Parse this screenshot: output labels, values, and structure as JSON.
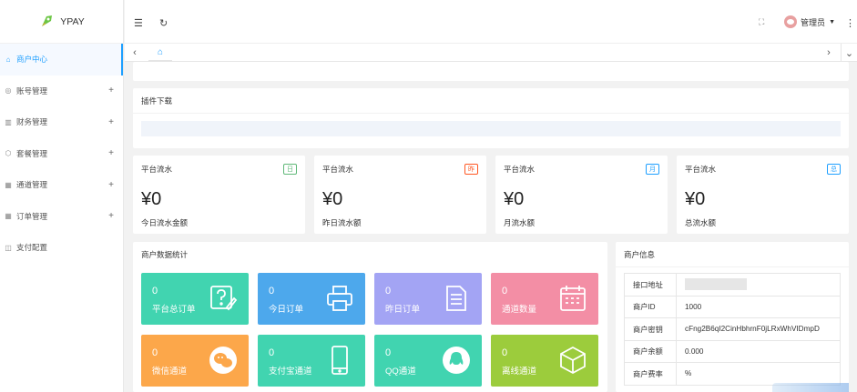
{
  "app": {
    "name": "YPAY"
  },
  "sidebar": {
    "items": [
      {
        "label": "商户中心",
        "icon": "home-icon"
      },
      {
        "label": "账号管理",
        "icon": "user-circle-icon"
      },
      {
        "label": "财务管理",
        "icon": "finance-icon"
      },
      {
        "label": "套餐管理",
        "icon": "package-icon"
      },
      {
        "label": "通道管理",
        "icon": "channel-icon"
      },
      {
        "label": "订单管理",
        "icon": "order-icon"
      },
      {
        "label": "支付配置",
        "icon": "config-icon"
      }
    ]
  },
  "topbar": {
    "user_label": "管理员"
  },
  "plugin": {
    "title": "插件下载"
  },
  "flows": [
    {
      "title": "平台流水",
      "badge": "日",
      "badge_color": "#5fb878",
      "value": "¥0",
      "sub": "今日流水金额"
    },
    {
      "title": "平台流水",
      "badge": "昨",
      "badge_color": "#ff5722",
      "value": "¥0",
      "sub": "昨日流水额"
    },
    {
      "title": "平台流水",
      "badge": "月",
      "badge_color": "#1e9fff",
      "value": "¥0",
      "sub": "月流水额"
    },
    {
      "title": "平台流水",
      "badge": "总",
      "badge_color": "#1e9fff",
      "value": "¥0",
      "sub": "总流水额"
    }
  ],
  "stats": {
    "title": "商户数据统计",
    "tiles": [
      {
        "value": "0",
        "label": "平台总订单",
        "color": "#41d4b0",
        "icon": "question-edit-icon"
      },
      {
        "value": "0",
        "label": "今日订单",
        "color": "#4da8ec",
        "icon": "printer-icon"
      },
      {
        "value": "0",
        "label": "昨日订单",
        "color": "#a3a4f4",
        "icon": "document-icon"
      },
      {
        "value": "0",
        "label": "通道数量",
        "color": "#f38ea5",
        "icon": "calendar-icon"
      },
      {
        "value": "0",
        "label": "微信通道",
        "color": "#fca74a",
        "icon": "wechat-icon"
      },
      {
        "value": "0",
        "label": "支付宝通道",
        "color": "#41d4b0",
        "icon": "phone-icon"
      },
      {
        "value": "0",
        "label": "QQ通道",
        "color": "#41d4b0",
        "icon": "qq-icon"
      },
      {
        "value": "0",
        "label": "离线通道",
        "color": "#9ccc3c",
        "icon": "cube-icon"
      }
    ]
  },
  "merchant": {
    "title": "商户信息",
    "rows": [
      {
        "key": "接口地址",
        "value": ""
      },
      {
        "key": "商户ID",
        "value": "1000"
      },
      {
        "key": "商户密钥",
        "value": "cFng2B6qI2CinHbhrnF0jLRxWhVIDmpD"
      },
      {
        "key": "商户余额",
        "value": "0.000"
      },
      {
        "key": "商户费率",
        "value": "%"
      }
    ]
  }
}
